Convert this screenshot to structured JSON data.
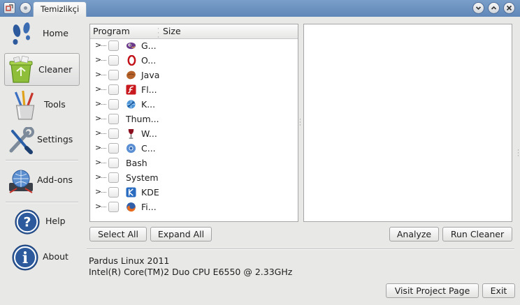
{
  "window": {
    "tab_title": "Temizlikçi"
  },
  "sidebar": {
    "items": [
      {
        "label": "Home"
      },
      {
        "label": "Cleaner"
      },
      {
        "label": "Tools"
      },
      {
        "label": "Settings"
      },
      {
        "label": "Add-ons"
      },
      {
        "label": "Help"
      },
      {
        "label": "About"
      }
    ]
  },
  "tree": {
    "columns": {
      "program": "Program",
      "size": "Size"
    },
    "rows": [
      {
        "label": "G...",
        "icon": "gimp-icon"
      },
      {
        "label": "O...",
        "icon": "opera-icon"
      },
      {
        "label": "Java",
        "icon": "java-icon"
      },
      {
        "label": "Fl...",
        "icon": "flash-icon"
      },
      {
        "label": "K...",
        "icon": "konqueror-icon"
      },
      {
        "label": "Thum...",
        "icon": ""
      },
      {
        "label": "W...",
        "icon": "wine-icon"
      },
      {
        "label": "C...",
        "icon": "chromium-icon"
      },
      {
        "label": "Bash",
        "icon": ""
      },
      {
        "label": "System",
        "icon": ""
      },
      {
        "label": "KDE",
        "icon": "kde-icon"
      },
      {
        "label": "Fi...",
        "icon": "firefox-icon"
      }
    ]
  },
  "buttons": {
    "select_all": "Select All",
    "expand_all": "Expand All",
    "analyze": "Analyze",
    "run_cleaner": "Run Cleaner",
    "visit_project": "Visit Project Page",
    "exit": "Exit"
  },
  "system_info": {
    "os": "Pardus Linux 2011",
    "cpu": "Intel(R) Core(TM)2 Duo CPU E6550 @ 2.33GHz"
  },
  "colors": {
    "titlebar": "#6a92c0",
    "window_bg": "#e8e8e7",
    "panel_bg": "#ffffff"
  }
}
